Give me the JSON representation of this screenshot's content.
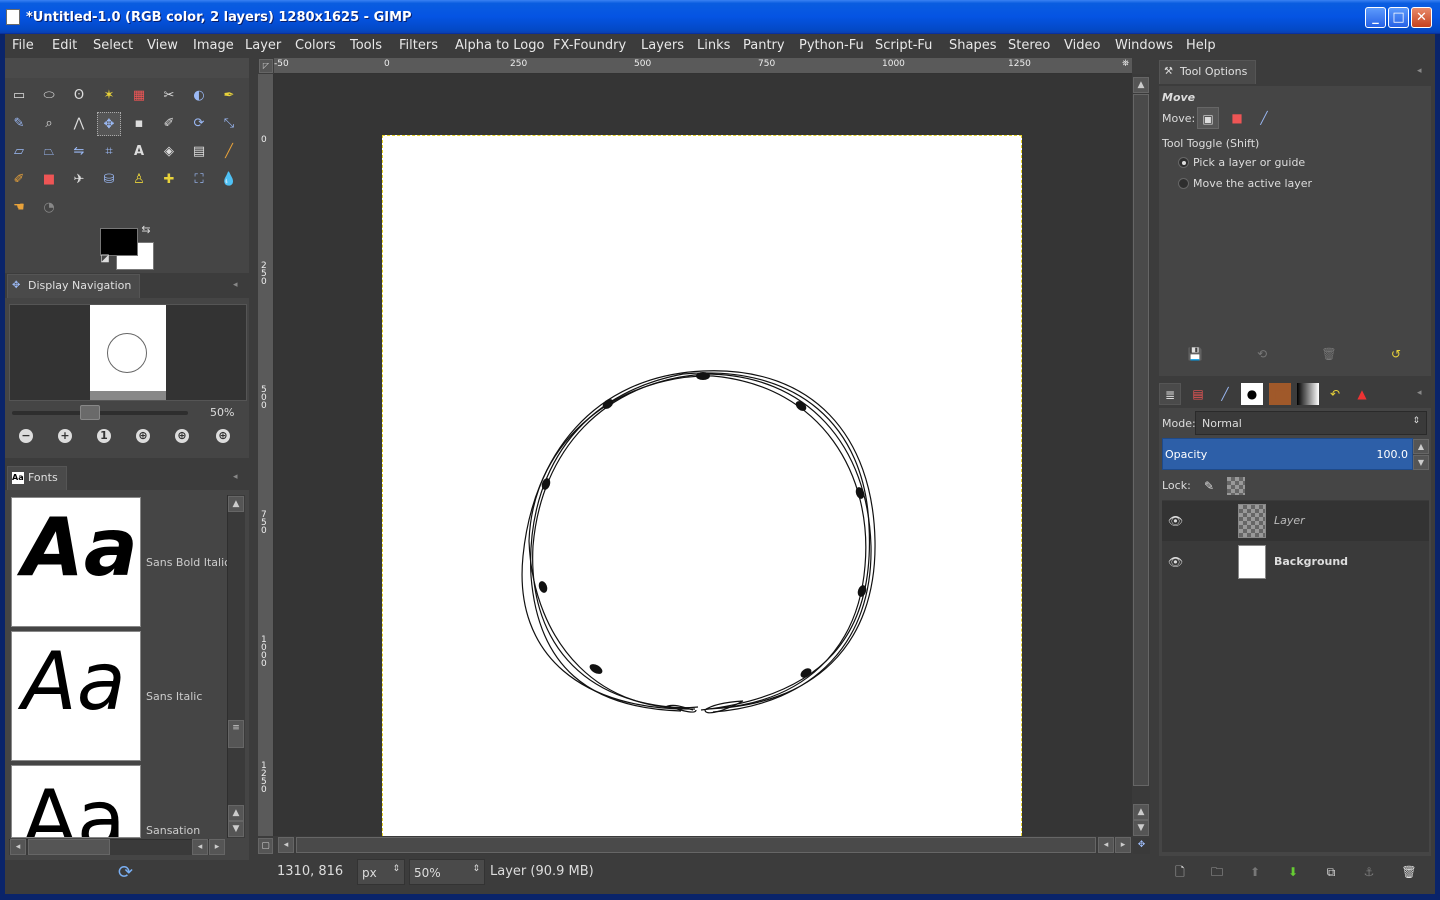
{
  "window": {
    "title": "*Untitled-1.0 (RGB color, 2 layers) 1280x1625 - GIMP",
    "minimize": "_",
    "maximize": "□",
    "close": "✕"
  },
  "menu": [
    "File",
    "Edit",
    "Select",
    "View",
    "Image",
    "Layer",
    "Colors",
    "Tools",
    "Filters",
    "Alpha to Logo",
    "FX-Foundry",
    "Layers",
    "Links",
    "Pantry",
    "Python-Fu",
    "Script-Fu",
    "Shapes",
    "Stereo",
    "Video",
    "Windows",
    "Help"
  ],
  "navigation": {
    "tab": "Display Navigation",
    "zoom": "50%"
  },
  "fonts": {
    "tab": "Fonts",
    "sample": "Aa",
    "items": [
      "Sans Bold Italic",
      "Sans Italic",
      "Sansation"
    ]
  },
  "ruler": {
    "h": [
      "-50",
      "0",
      "250",
      "500",
      "750",
      "1000",
      "1250"
    ],
    "v": [
      "0",
      "250",
      "500",
      "750",
      "1000",
      "1250"
    ]
  },
  "status": {
    "coords": "1310, 816",
    "unit": "px",
    "zoom": "50",
    "zoom_suffix": "%",
    "message": "Layer (90.9 MB)"
  },
  "tool_options": {
    "tab": "Tool Options",
    "heading": "Move",
    "move_label": "Move:",
    "toggle_label": "Tool Toggle  (Shift)",
    "option1": "Pick a layer or guide",
    "option2": "Move the active layer"
  },
  "layers": {
    "mode_label": "Mode:",
    "mode_value": "Normal",
    "opacity_label": "Opacity",
    "opacity_value": "100.0",
    "lock_label": "Lock:",
    "items": [
      "Layer",
      "Background"
    ]
  }
}
